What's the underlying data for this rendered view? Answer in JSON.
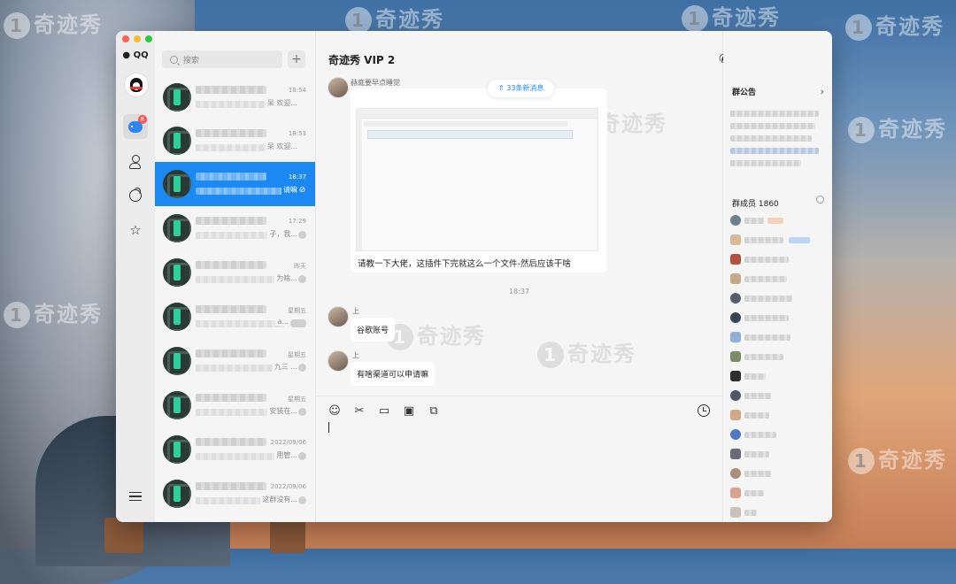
{
  "watermark": {
    "text": "奇迹秀",
    "badge": "1"
  },
  "app": {
    "name": "QQ"
  },
  "rail": {
    "unread_badge": "8"
  },
  "search": {
    "placeholder": "搜索",
    "add_label": "+"
  },
  "conversations": [
    {
      "time": "18:54",
      "preview_tail": "呆 欢迎..."
    },
    {
      "time": "18:53",
      "preview_tail": "呆 欢迎..."
    },
    {
      "time": "18:37",
      "preview_tail": "请嘛"
    },
    {
      "time": "17:29",
      "preview_tail": "子，我..."
    },
    {
      "time": "昨天",
      "preview_tail": "为啥..."
    },
    {
      "time": "星期五",
      "preview_tail": "a..."
    },
    {
      "time": "星期五",
      "preview_tail": "九三 ..."
    },
    {
      "time": "星期五",
      "preview_tail": "安装在..."
    },
    {
      "time": "2022/09/06",
      "preview_tail": "用管..."
    },
    {
      "time": "2022/09/06",
      "preview_tail": "这群没有..."
    }
  ],
  "chat": {
    "title": "奇迹秀 VIP 2",
    "new_messages": "33条新消息",
    "messages": [
      {
        "sender": "赫庭要早点睡觉",
        "caption": "请教一下大佬，这插件下完就这么一个文件-然后应该干啥"
      },
      {
        "sender": "上",
        "text": "谷歌账号"
      },
      {
        "sender": "上",
        "text": "有啥渠道可以申请嘛"
      }
    ],
    "time_separator": "18:37"
  },
  "panel": {
    "announcement_title": "群公告",
    "members_title": "群成员 1860"
  }
}
